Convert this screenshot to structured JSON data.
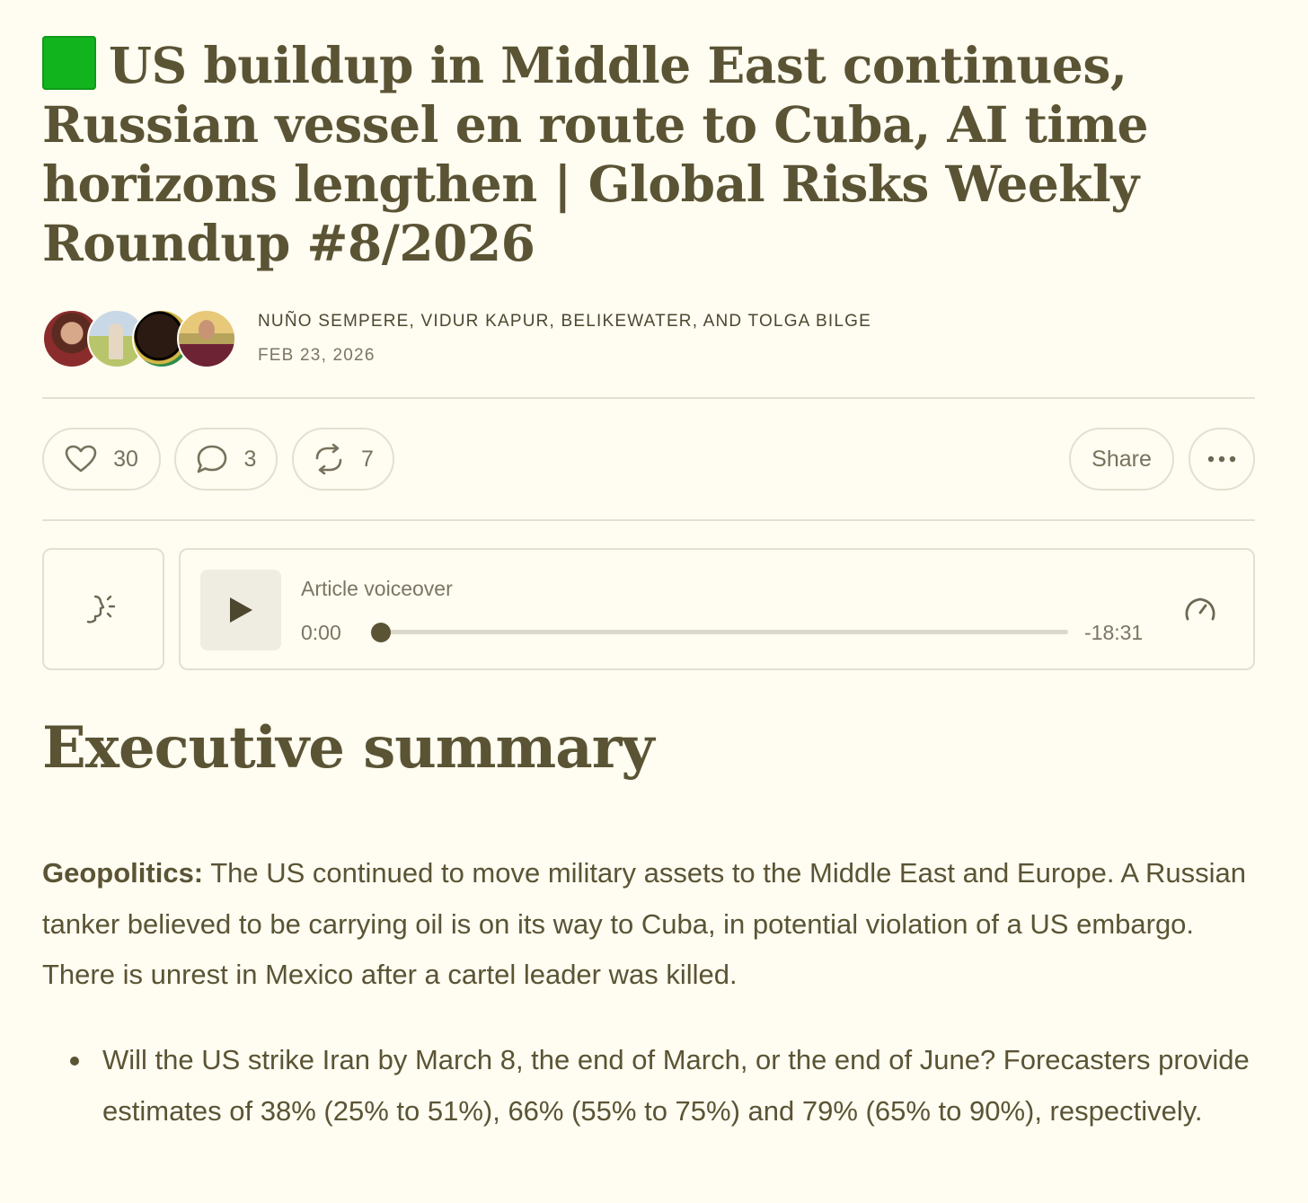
{
  "post": {
    "title": "US buildup in Middle East continues, Russian vessel en route to Cuba, AI time horizons lengthen | Global Risks Weekly Roundup #8/2026",
    "title_emoji_color": "#12b41e",
    "authors": "NUÑO SEMPERE, VIDUR KAPUR, BELIKEWATER, AND TOLGA BILGE",
    "date": "FEB 23, 2026"
  },
  "actions": {
    "like_count": "30",
    "comment_count": "3",
    "restack_count": "7",
    "share_label": "Share",
    "more_icon": "ellipsis-icon"
  },
  "voiceover": {
    "label": "Article voiceover",
    "time_start": "0:00",
    "time_end": "-18:31",
    "progress_fraction": 0
  },
  "content": {
    "heading": "Executive summary",
    "geo_label": "Geopolitics:",
    "geo_text": " The US continued to move military assets to the Middle East and Europe. A Russian tanker believed to be carrying oil is on its way to Cuba, in potential violation of a US embargo. There is unrest in Mexico after a cartel leader was killed.",
    "bullets": [
      "Will the US strike Iran by March 8, the end of March, or the end of June? Forecasters provide estimates of 38% (25% to 51%), 66% (55% to 75%) and 79% (65% to 90%), respectively."
    ]
  },
  "colors": {
    "background": "#fffcf1",
    "text": "#5a5435",
    "muted": "#7b7663",
    "border": "#e3dfd1"
  }
}
